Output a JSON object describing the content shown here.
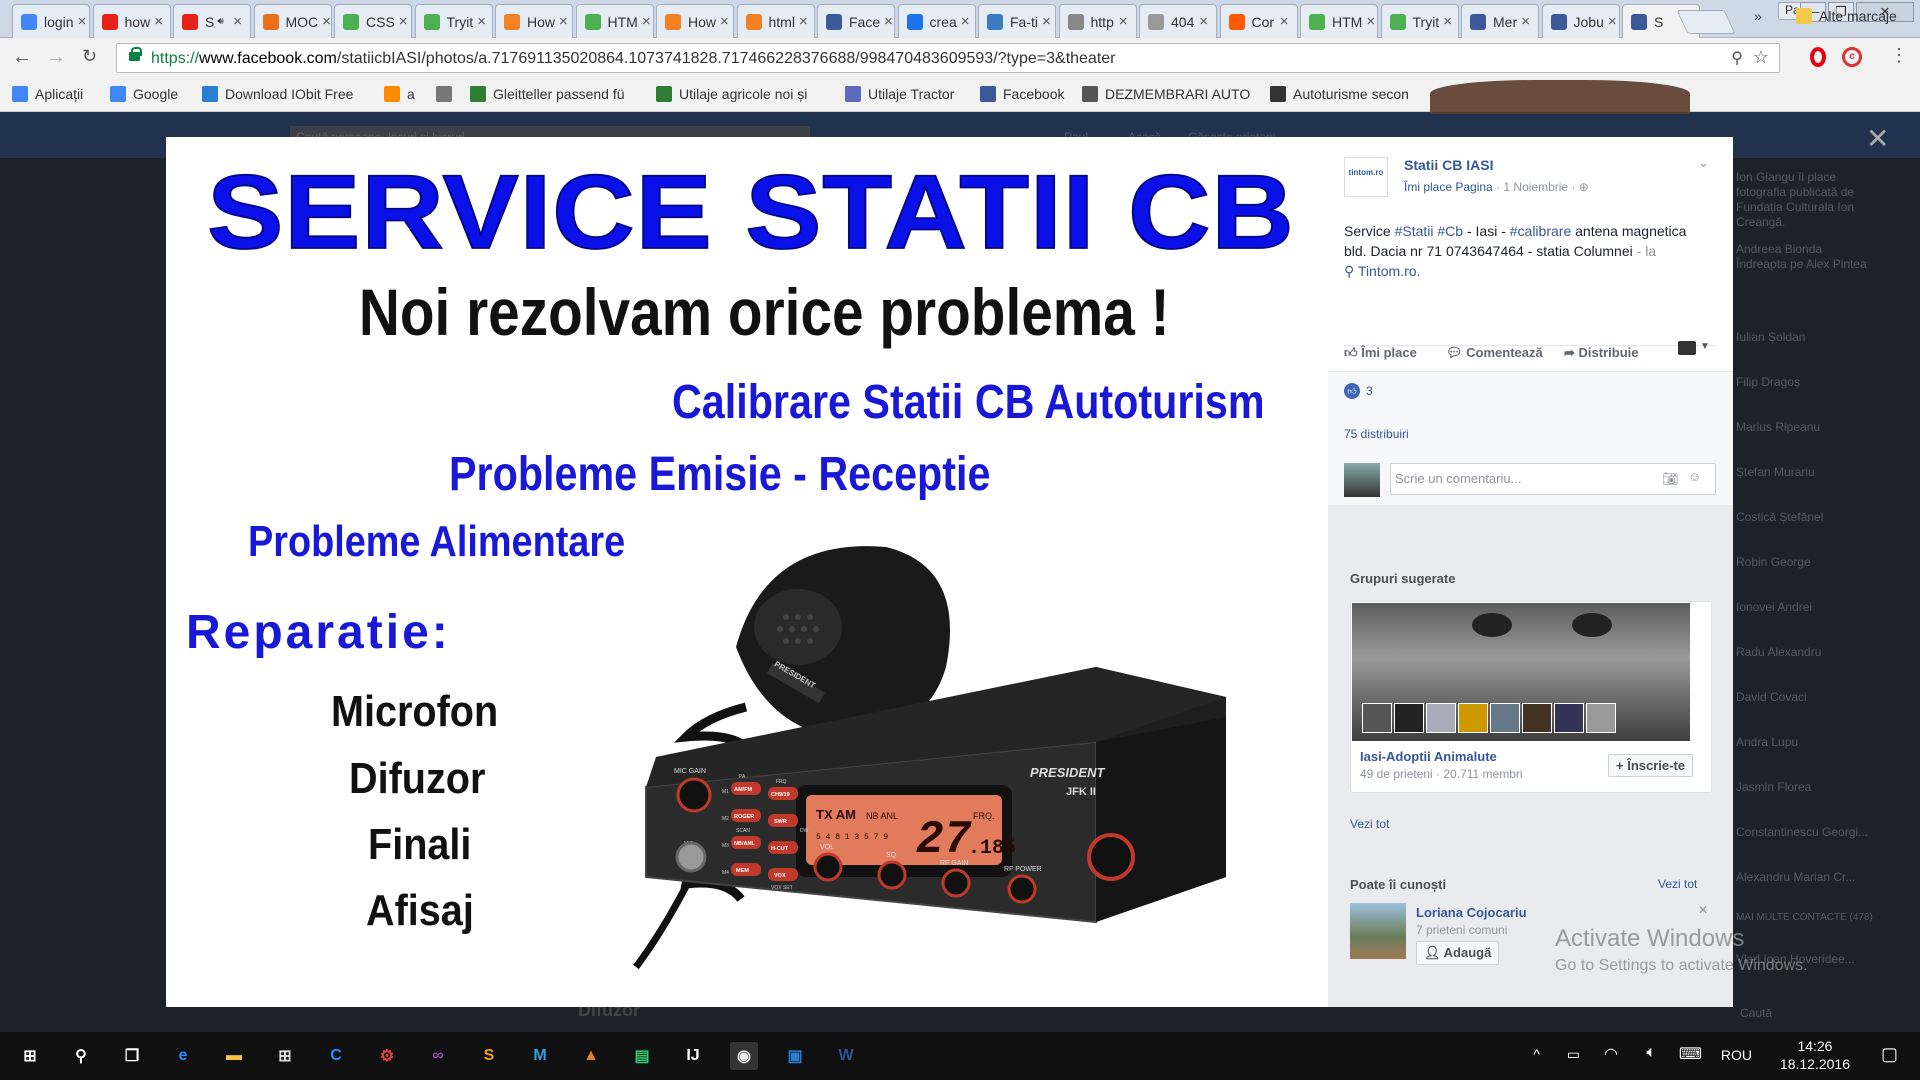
{
  "browser": {
    "tabs": [
      {
        "label": "login",
        "icon": "google-icon",
        "color": "#4285f4"
      },
      {
        "label": "how",
        "icon": "youtube-icon",
        "color": "#e62117"
      },
      {
        "label": "S",
        "icon": "youtube-icon",
        "color": "#e62117",
        "audio": true
      },
      {
        "label": "MOC",
        "icon": "moc-icon",
        "color": "#e96f1a"
      },
      {
        "label": "CSS",
        "icon": "w3schools-icon",
        "color": "#4caf50"
      },
      {
        "label": "Tryit",
        "icon": "w3schools-icon",
        "color": "#4caf50"
      },
      {
        "label": "How",
        "icon": "stackoverflow-icon",
        "color": "#f48024"
      },
      {
        "label": "HTM",
        "icon": "w3schools-icon",
        "color": "#4caf50"
      },
      {
        "label": "How",
        "icon": "stackoverflow-icon",
        "color": "#f48024"
      },
      {
        "label": "html",
        "icon": "stackoverflow-icon",
        "color": "#f48024"
      },
      {
        "label": "Face",
        "icon": "facebook-icon",
        "color": "#3b5998"
      },
      {
        "label": "crea",
        "icon": "link-icon",
        "color": "#1a73e8"
      },
      {
        "label": "Fa-ti",
        "icon": "r-icon",
        "color": "#3b7bbf"
      },
      {
        "label": "http",
        "icon": "page-icon",
        "color": "#888888"
      },
      {
        "label": "404",
        "icon": "404-icon",
        "color": "#999999"
      },
      {
        "label": "Cor",
        "icon": "cp-icon",
        "color": "#ff5a00"
      },
      {
        "label": "HTM",
        "icon": "w3schools-icon",
        "color": "#4caf50"
      },
      {
        "label": "Tryit",
        "icon": "w3schools-icon",
        "color": "#4caf50"
      },
      {
        "label": "Mer",
        "icon": "facebook-icon",
        "color": "#3b5998"
      },
      {
        "label": "Jobu",
        "icon": "facebook-icon",
        "color": "#3b5998"
      },
      {
        "label": "S",
        "icon": "facebook-icon",
        "color": "#3b5998",
        "active": true
      }
    ],
    "profile": "Paul",
    "url": {
      "scheme": "https://",
      "domain": "www.facebook.com",
      "path": "/statiicbIASI/photos/a.717691135020864.1073741828.717466228376688/998470483609593/?type=3&theater"
    },
    "bookmarks": [
      {
        "label": "Aplicații",
        "icon": "apps-icon",
        "color": "#4285f4"
      },
      {
        "label": "Google",
        "icon": "google-icon",
        "color": "#4285f4"
      },
      {
        "label": "Download IObit Free",
        "icon": "iobit-icon",
        "color": "#2a7fd4"
      },
      {
        "label": "a",
        "icon": "a-icon",
        "color": "#ff8c00"
      },
      {
        "label": "",
        "icon": "page-icon",
        "color": "#777777"
      },
      {
        "label": "Gleitteller passend fü",
        "icon": "gleitteller-icon",
        "color": "#2e7d32"
      },
      {
        "label": "Utilaje agricole noi și",
        "icon": "tractor-icon",
        "color": "#2e7d32"
      },
      {
        "label": "Utilaje Tractor",
        "icon": "gear-icon",
        "color": "#5c6bc0"
      },
      {
        "label": "Facebook",
        "icon": "facebook-icon",
        "color": "#3b5998"
      },
      {
        "label": "DEZMEMBRARI AUTO",
        "icon": "wrench-icon",
        "color": "#555555"
      },
      {
        "label": "Autoturisme secon",
        "icon": "owl-icon",
        "color": "#333333"
      }
    ],
    "more_bookmarks": "»",
    "other_bookmarks": "Alte marcaje"
  },
  "photo": {
    "headline": "SERVICE STATII CB",
    "subheadline": "Noi rezolvam orice problema !",
    "line1": "Calibrare Statii CB Autoturism",
    "line2": "Probleme Emisie - Receptie",
    "line3": "Probleme Alimentare",
    "repair_title": "Reparatie:",
    "repair_items": [
      "Microfon",
      "Difuzor",
      "Finali",
      "Afisaj"
    ],
    "radio": {
      "brand": "PRESIDENT",
      "model": "JFK II",
      "display_channel": "27",
      "display_freq": ".185",
      "display_left": "TX AM",
      "display_mode": "NB ANL",
      "display_freq_label": "FRQ.",
      "display_bottom": "5 4 8 1 3 5 7 9",
      "knobs": [
        "MIC GAIN",
        "VOL",
        "SQ",
        "RF GAIN",
        "RF POWER"
      ],
      "buttons": [
        "AM/FM",
        "CH9/19",
        "ROGER",
        "SWR",
        "NB/ANL",
        "H-CUT",
        "MEM",
        "VOX"
      ],
      "button_labels": [
        "PA",
        "FRQ",
        "M1",
        "M2",
        "M3",
        "M4",
        "SCAN",
        "DW",
        "VOX SET",
        "MIC"
      ],
      "mic_brand": "PRESIDENT"
    }
  },
  "sidebar": {
    "page_avatar_text": "tintom.ro",
    "page_name": "Statii CB IASI",
    "like_page": "Îmi place Pagina",
    "date": "1 Noiembrie",
    "post_text_parts": {
      "service": "Service",
      "hashtags": [
        "#Statii",
        "#Cb"
      ],
      "location_text": "- Iasi -",
      "hashtag3": "#calibrare",
      "antenna": "antena magnetica",
      "address": "bld. Dacia nr 71 0743647464 - statia Columnei",
      "at_label": "- la",
      "place": "Tintom.ro."
    },
    "actions": {
      "like": "Îmi place",
      "comment": "Comentează",
      "share": "Distribuie"
    },
    "reactions_count": "3",
    "shares": "75 distribuiri",
    "comment_placeholder": "Scrie un comentariu...",
    "groups_title": "Grupuri sugerate",
    "group": {
      "name": "Iasi-Adoptii Animalute",
      "meta": "49 de prieteni · 20.711 membri",
      "join": "Înscrie-te"
    },
    "see_all_groups": "Vezi tot",
    "people_title": "Poate îi cunoști",
    "see_all_people": "Vezi tot",
    "person": {
      "name": "Loriana Cojocariu",
      "meta": "7 prieteni comuni",
      "add": "Adaugă"
    }
  },
  "background_page": {
    "search_placeholder": "Caută persoane, locuri și lucruri",
    "nav": [
      "Paul",
      "Acasă",
      "Găsește prieteni"
    ],
    "ticker": [
      "Ion Giangu îi place",
      "fotografia publicată de",
      "Fundația Culturala Ion",
      "Creangă.",
      "Andreea Bionda",
      "Îndreapta pe Alex Pintea"
    ],
    "chat_names": [
      "Iulian Șoldan",
      "Filip Dragoș",
      "Marius Ripeanu",
      "Ștefan Murariu",
      "Costică Ștefănel",
      "Robin George",
      "Ionovei Andrei",
      "Radu Alexandru",
      "David Covaci",
      "Andra Lupu",
      "Jasmin Florea",
      "Constantinescu Georgi...",
      "Alexandru Marian Cr..."
    ],
    "more_contacts": "MAI MULTE CONTACTE (478)",
    "more_contacts_name": "Vlad Ioan Hoveridee...",
    "search_chat": "Caută",
    "behind_text": "Difuzor"
  },
  "watermark": {
    "title": "Activate Windows",
    "subtitle": "Go to Settings to activate Windows."
  },
  "taskbar": {
    "apps": [
      "start-icon",
      "search-icon",
      "task-view-icon",
      "edge-icon",
      "file-explorer-icon",
      "store-icon",
      "app-blue-icon",
      "app-red-icon",
      "visual-studio-icon",
      "sublime-icon",
      "app-m-icon",
      "matlab-icon",
      "app-green-icon",
      "intellij-icon",
      "chrome-icon",
      "app-square-icon",
      "word-icon"
    ],
    "language": "ROU",
    "time": "14:26",
    "date": "18.12.2016"
  }
}
